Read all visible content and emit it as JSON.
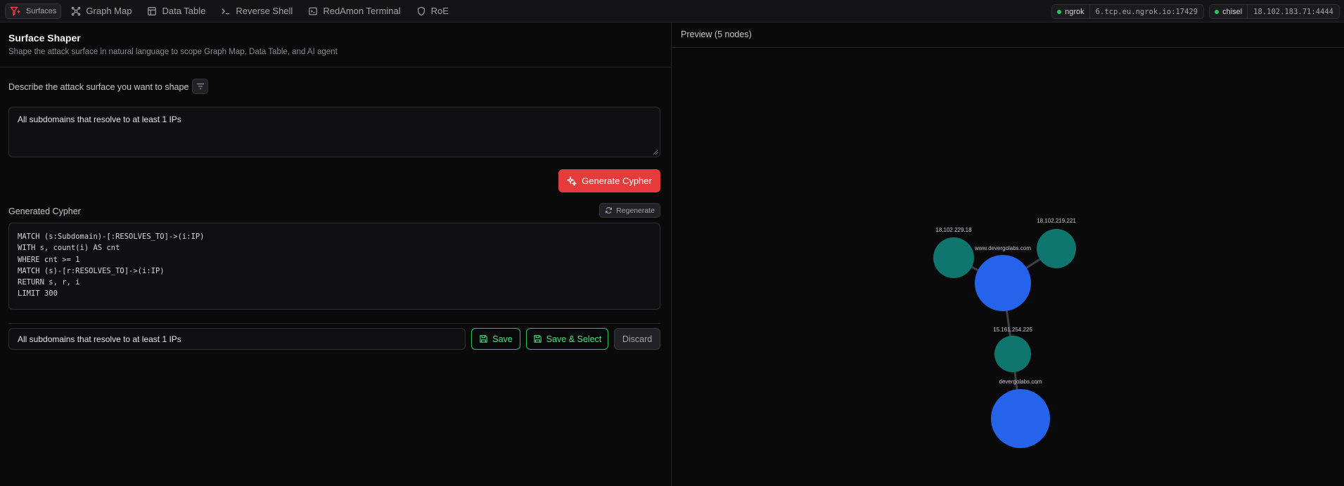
{
  "nav": {
    "surfaces": "Surfaces",
    "graph_map": "Graph Map",
    "data_table": "Data Table",
    "reverse_shell": "Reverse Shell",
    "terminal": "RedAmon Terminal",
    "roe": "RoE"
  },
  "tunnels": [
    {
      "name": "ngrok",
      "address": "6.tcp.eu.ngrok.io:17429",
      "status_color": "#22c55e"
    },
    {
      "name": "chisel",
      "address": "18.102.183.71:4444",
      "status_color": "#22c55e"
    }
  ],
  "shaper": {
    "title": "Surface Shaper",
    "subtitle": "Shape the attack surface in natural language to scope Graph Map, Data Table, and AI agent",
    "describe_label": "Describe the attack surface you want to shape",
    "prompt_value": "All subdomains that resolve to at least 1 IPs",
    "generate_label": "Generate Cypher",
    "generated_label": "Generated Cypher",
    "regenerate_label": "Regenerate",
    "cypher": "MATCH (s:Subdomain)-[:RESOLVES_TO]->(i:IP)\nWITH s, count(i) AS cnt\nWHERE cnt >= 1\nMATCH (s)-[r:RESOLVES_TO]->(i:IP)\nRETURN s, r, i\nLIMIT 300",
    "name_value": "All subdomains that resolve to at least 1 IPs",
    "save_label": "Save",
    "save_select_label": "Save & Select",
    "discard_label": "Discard"
  },
  "preview": {
    "title": "Preview (5 nodes)",
    "nodes": [
      {
        "label": "18.102.229.18",
        "type": "ip"
      },
      {
        "label": "18.102.219.221",
        "type": "ip"
      },
      {
        "label": "www.devergolabs.com",
        "type": "subdomain"
      },
      {
        "label": "15.161.254.225",
        "type": "ip"
      },
      {
        "label": "devergolabs.com",
        "type": "subdomain"
      }
    ],
    "colors": {
      "ip": "#0f766e",
      "subdomain": "#2563eb",
      "edge": "#3f3f46"
    }
  }
}
